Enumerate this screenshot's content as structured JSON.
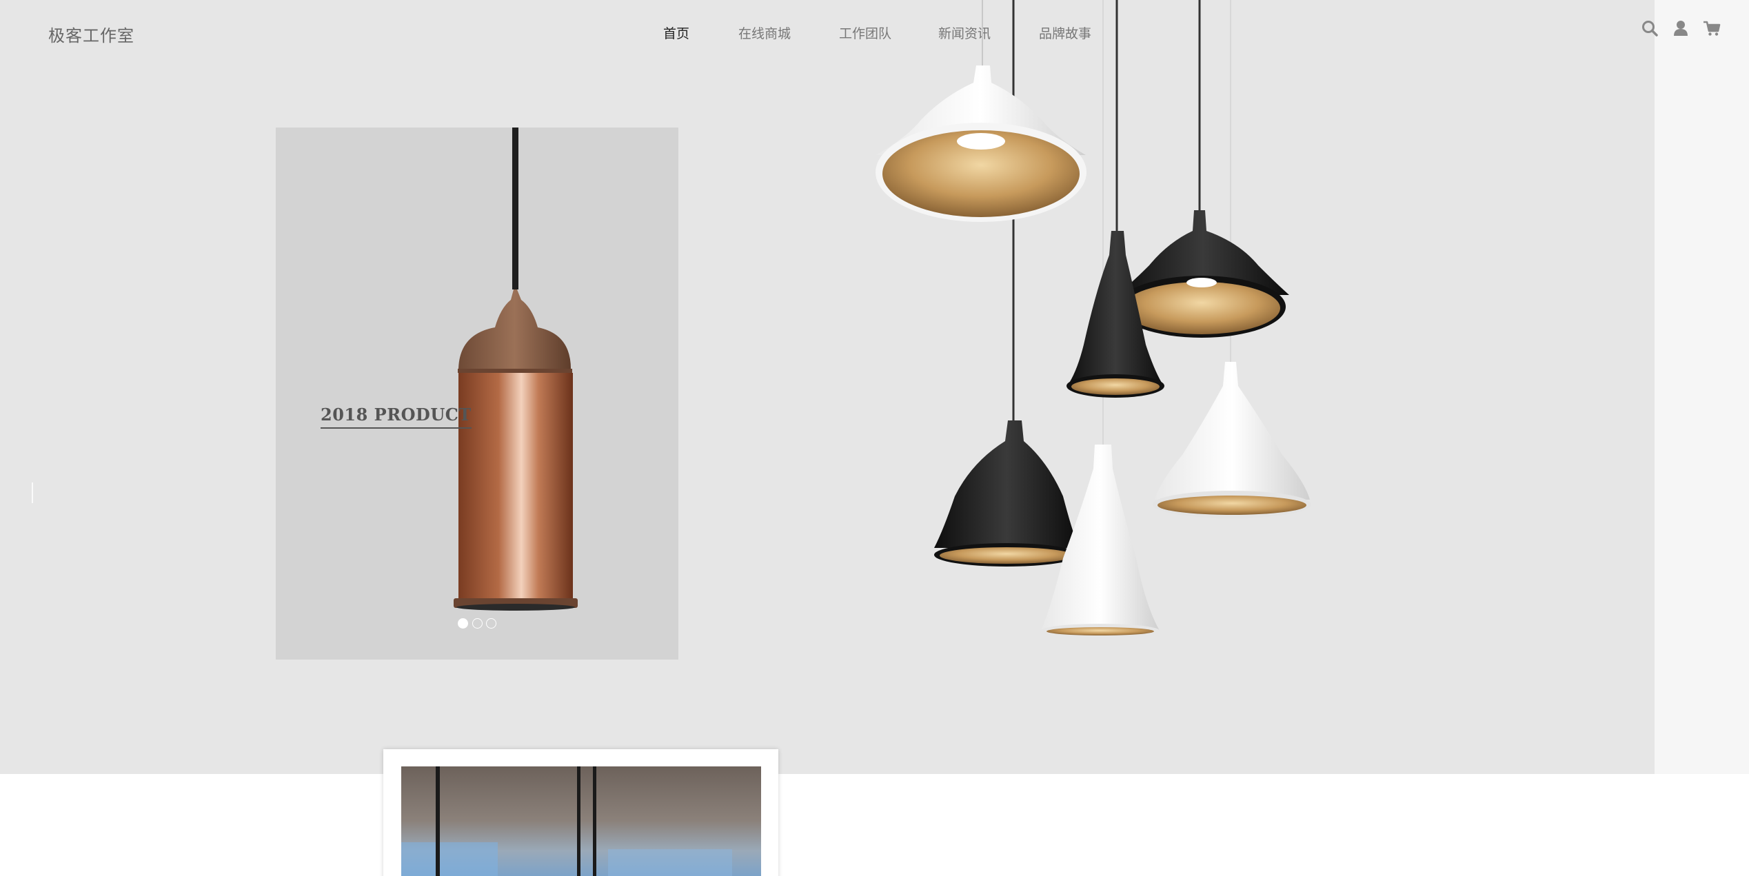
{
  "brand": {
    "name": "极客工作室"
  },
  "nav": {
    "items": [
      {
        "label": "首页",
        "active": true
      },
      {
        "label": "在线商城",
        "active": false
      },
      {
        "label": "工作团队",
        "active": false
      },
      {
        "label": "新闻资讯",
        "active": false
      },
      {
        "label": "品牌故事",
        "active": false
      }
    ]
  },
  "header_icons": [
    {
      "icon": "search-icon"
    },
    {
      "icon": "user-icon"
    },
    {
      "icon": "cart-icon"
    }
  ],
  "slider": {
    "caption": "2018 PRODUCT",
    "slide_count": 3,
    "active_slide": 1
  },
  "colors": {
    "hero_bg": "#e6e6e6",
    "card_bg": "#d3d3d3",
    "copper": "#b06a46",
    "gold": "#c9a062",
    "black_shade": "#1c1c1c",
    "white_shade": "#f2f2f2"
  }
}
